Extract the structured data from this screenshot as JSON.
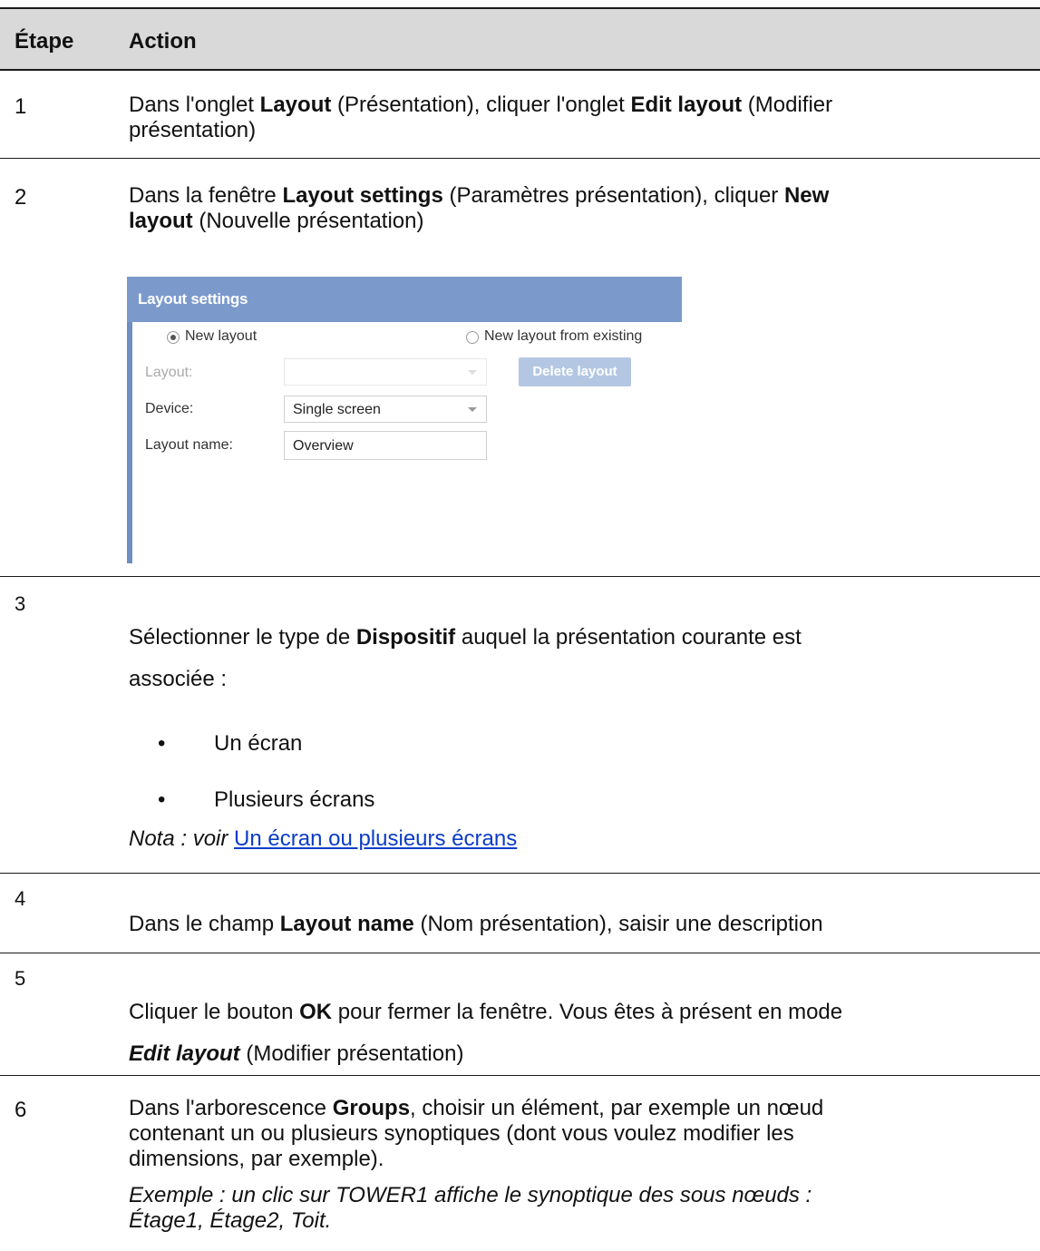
{
  "header": {
    "col1": "Étape",
    "col2": "Action"
  },
  "steps": [
    {
      "number": "1",
      "line1": [
        "Dans l'onglet ",
        "Layout",
        " (Présentation), cliquer l'onglet ",
        "Edit layout",
        " (Modifier"
      ],
      "line2": "présentation)"
    },
    {
      "number": "2",
      "line1": [
        "Dans la fenêtre ",
        "Layout settings",
        " (Paramètres présentation), cliquer ",
        "New"
      ],
      "line2": [
        "layout",
        " (Nouvelle présentation)"
      ]
    },
    {
      "number": "3",
      "line1": [
        "Sélectionner le type de ",
        "Dispositif",
        " auquel la présentation courante est"
      ],
      "line2": "associée :",
      "bullets": [
        "Un écran",
        "Plusieurs écrans"
      ],
      "note_prefix": "Nota : voir",
      "note_link": "Un écran ou plusieurs écrans"
    },
    {
      "number": "4",
      "line1": [
        "Dans le champ ",
        "Layout name",
        " (Nom présentation), saisir une description"
      ]
    },
    {
      "number": "5",
      "line1": [
        "Cliquer le bouton ",
        "OK",
        " pour fermer la fenêtre. Vous êtes à présent en mode"
      ],
      "line2": [
        "Edit layout",
        " (Modifier présentation)"
      ]
    },
    {
      "number": "6",
      "line1": [
        "Dans l'arborescence ",
        "Groups",
        ", choisir un élément, par exemple un nœud"
      ],
      "line2": "contenant un ou plusieurs synoptiques (dont vous voulez modifier les",
      "line3": "dimensions, par exemple).",
      "example1": "Exemple : un clic sur TOWER1 affiche le synoptique des sous nœuds :",
      "example2": "Étage1, Étage2, Toit."
    }
  ],
  "dialog": {
    "title": "Layout settings",
    "radio_new": "New layout",
    "radio_existing": "New layout from existing",
    "layout_label": "Layout:",
    "layout_value": "",
    "delete_button": "Delete layout",
    "device_label": "Device:",
    "device_value": "Single screen",
    "name_label": "Layout name:",
    "name_value": "Overview"
  }
}
